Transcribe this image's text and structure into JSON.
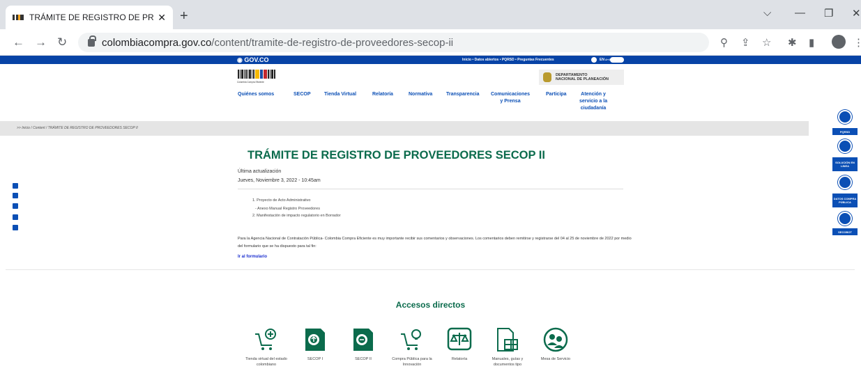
{
  "browser": {
    "tab_title": "TRÁMITE DE REGISTRO DE PROV",
    "tab_close": "✕",
    "new_tab": "+",
    "url_host": "colombiacompra.gov.co",
    "url_path": "/content/tramite-de-registro-de-proveedores-secop-ii"
  },
  "govbar": {
    "logo": "GOV.CO",
    "links": "Inicio  • Datos abiertos  • PQRSD  • Preguntas Frecuentes",
    "en": "EN",
    "a_plus": "A+A"
  },
  "header": {
    "logo_caption": "Colombia Compra Eficiente",
    "dnp_line1": "DEPARTAMENTO",
    "dnp_line2": "NACIONAL DE PLANEACIÓN"
  },
  "menu": [
    {
      "label": "Quiénes somos"
    },
    {
      "label": "SECOP"
    },
    {
      "label": "Tienda Virtual"
    },
    {
      "label": "Relatoría"
    },
    {
      "label": "Normativa"
    },
    {
      "label": "Transparencia"
    },
    {
      "label": "Comunicaciones",
      "label2": "y Prensa"
    },
    {
      "label": "Participa"
    },
    {
      "label": "Atención y",
      "label2": "servicio a la",
      "label3": "ciudadanía"
    }
  ],
  "breadcrumb": ">> Inicio / Content / TRÁMITE DE REGISTRO DE PROVEEDORES SECOP II",
  "content": {
    "title": "TRÁMITE DE REGISTRO DE PROVEEDORES SECOP II",
    "update_label": "Última actualización",
    "update_date": "Jueves, Noviembre 3, 2022 - 10:45am",
    "items": [
      "1. Proyecto de Acto Administrativo",
      "- Anexo Manual Registro Proveedores",
      "2. Manifestación de impacto regulatorio en Borrador"
    ],
    "paragraph": "Para la Agencia Nacional de Contratación Pública- Colombia Compra Eficiente es muy importante recibir sus comentarios y observaciones.  Los comentarios deben remitirse y registrarse del 04 al 25 de noviembre de 2022 por medio del formulario que se ha dispuesto para tal fin:",
    "form_link": "Ir al formulario"
  },
  "sidebar_buttons": [
    {
      "label": "PQRSD"
    },
    {
      "label": "SOLUCIÓN EN LINEA"
    },
    {
      "label": "DATOS COMPRA PÚBLICA"
    },
    {
      "label": "SECOBOT"
    }
  ],
  "accesos": {
    "title": "Accesos directos",
    "items": [
      {
        "label": "Tienda virtual del estado colombiano",
        "icon": "cart-plus-icon"
      },
      {
        "label": "SECOP I",
        "icon": "document-secop1-icon"
      },
      {
        "label": "SECOP II",
        "icon": "document-secop2-icon"
      },
      {
        "label": "Compra Pública para la Innovación",
        "icon": "cart-bulb-icon"
      },
      {
        "label": "Relatoría",
        "icon": "balance-icon"
      },
      {
        "label": "Manuales, guías y documentos tipo",
        "icon": "document-grid-icon"
      },
      {
        "label": "Mesa de Servicio",
        "icon": "support-people-icon"
      }
    ]
  },
  "colors": {
    "gov_blue": "#0743a6",
    "link_blue": "#0b4fb5",
    "title_green": "#0b6b4c"
  }
}
